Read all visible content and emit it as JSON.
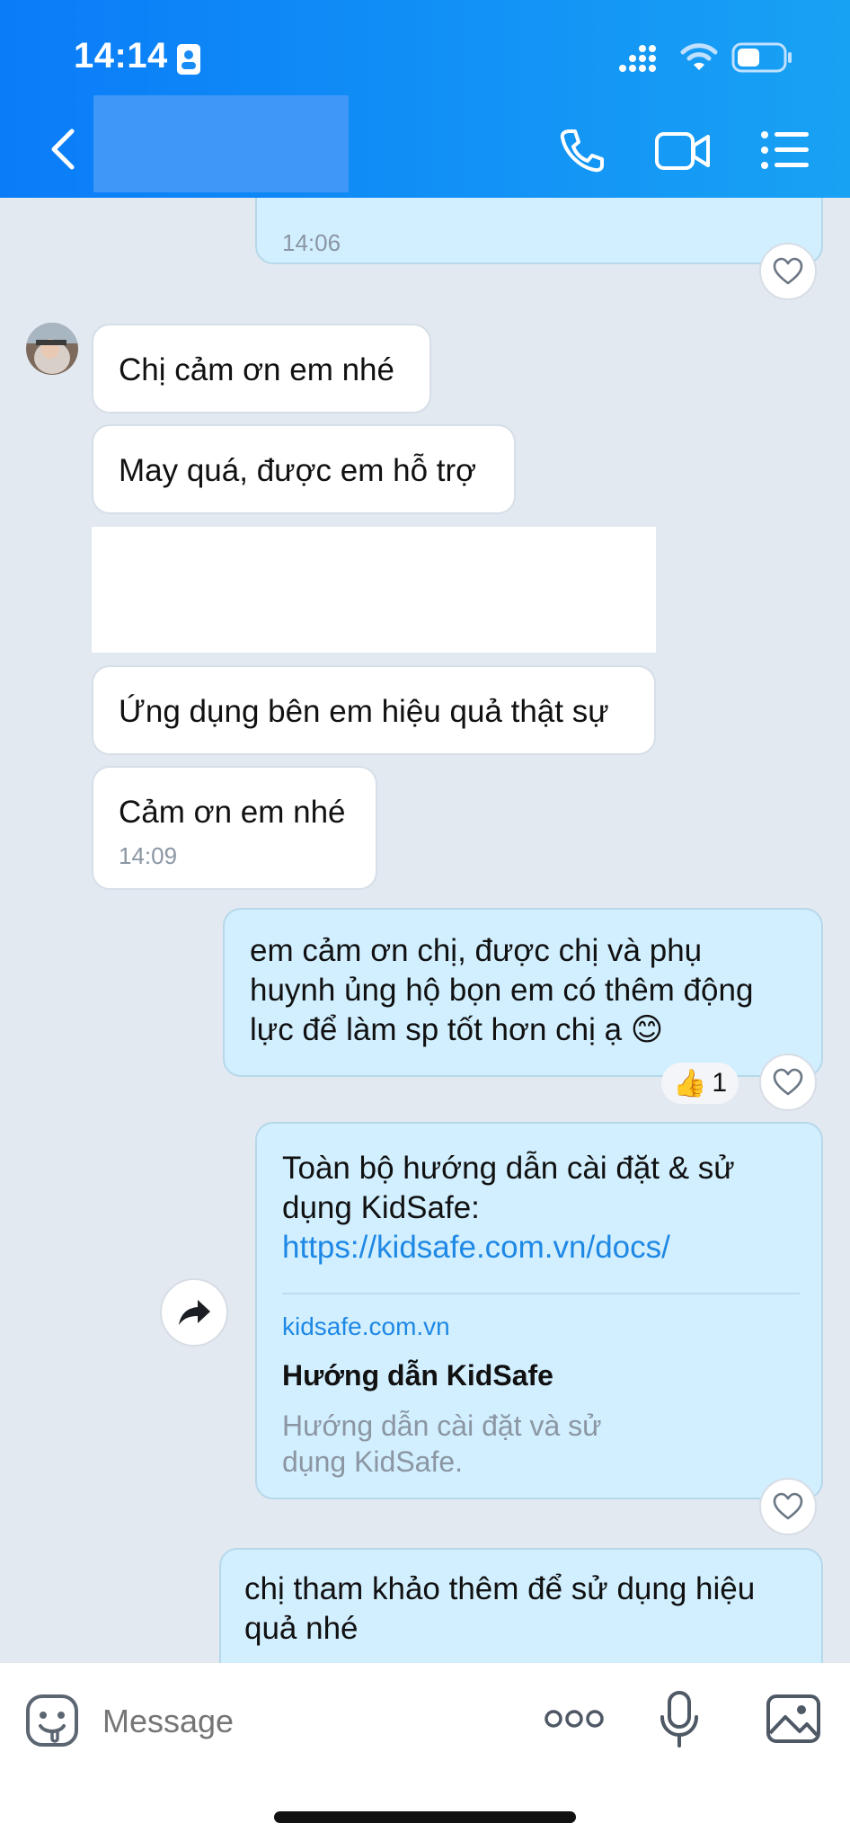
{
  "status_bar": {
    "time": "14:14"
  },
  "header": {
    "title": ""
  },
  "messages": {
    "top_time": "14:06",
    "m1": "Chị cảm ơn em nhé",
    "m2": "May quá, được em hỗ trợ",
    "m4": "Ứng dụng bên em hiệu quả thật sự",
    "m5": "Cảm ơn em nhé",
    "m5_time": "14:09",
    "m6_l1": "em cảm ơn chị, được chị và phụ",
    "m6_l2": "huynh ủng hộ bọn em có thêm động",
    "m6_l3": "lực để làm sp tốt hơn chị ạ 😊",
    "m6_reaction_count": "1",
    "m7_l1": "Toàn bộ hướng dẫn cài đặt & sử",
    "m7_l2": "dụng KidSafe:",
    "m7_url": "https://kidsafe.com.vn/docs/",
    "preview_domain": "kidsafe.com.vn",
    "preview_title": "Hướng dẫn KidSafe",
    "preview_desc_l1": "Hướng dẫn cài đặt và sử",
    "preview_desc_l2": "dụng KidSafe.",
    "m8_l1": "chị tham khảo thêm để sử dụng hiệu",
    "m8_l2": "quả nhé"
  },
  "composer": {
    "placeholder": "Message"
  },
  "colors": {
    "header_start": "#0a7cf8",
    "header_end": "#18a2f4",
    "outgoing": "#d2efff",
    "incoming": "#ffffff",
    "link": "#1e88e5"
  }
}
